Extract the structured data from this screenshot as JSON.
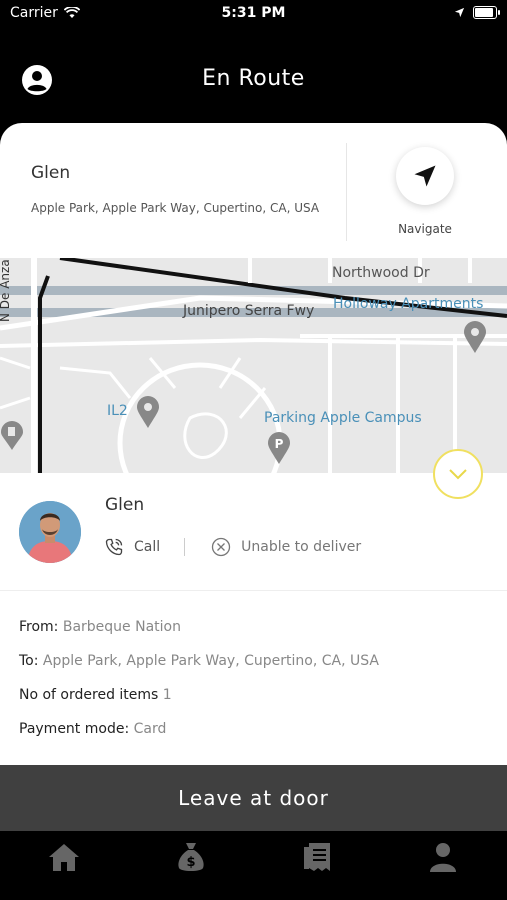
{
  "status_bar": {
    "carrier": "Carrier",
    "time": "5:31 PM"
  },
  "header": {
    "title": "En Route"
  },
  "destination": {
    "name": "Glen",
    "address": "Apple Park, Apple Park Way, Cupertino, CA, USA",
    "navigate_label": "Navigate"
  },
  "map": {
    "labels": {
      "northwood": "Northwood Dr",
      "junipero": "Junipero Serra Fwy",
      "holloway": "Holloway Apartments",
      "de_anza": "N De Anza Blvd",
      "il2": "IL2",
      "parking": "Parking Apple Campus"
    }
  },
  "customer": {
    "name": "Glen",
    "call_label": "Call",
    "unable_label": "Unable to deliver"
  },
  "order": {
    "from_label": "From:",
    "from_value": "Barbeque Nation",
    "to_label": "To:",
    "to_value": "Apple Park, Apple Park Way, Cupertino, CA, USA",
    "items_label": "No of ordered items",
    "items_value": "1",
    "payment_label": "Payment mode:",
    "payment_value": "Card"
  },
  "cta": {
    "label": "Leave at door"
  },
  "tabbar": {
    "items": [
      {
        "icon": "home-icon"
      },
      {
        "icon": "money-bag-icon"
      },
      {
        "icon": "orders-icon"
      },
      {
        "icon": "account-icon"
      }
    ]
  },
  "colors": {
    "accent": "#f0e060",
    "cta_bg": "#404040",
    "header_bg": "#000000"
  }
}
